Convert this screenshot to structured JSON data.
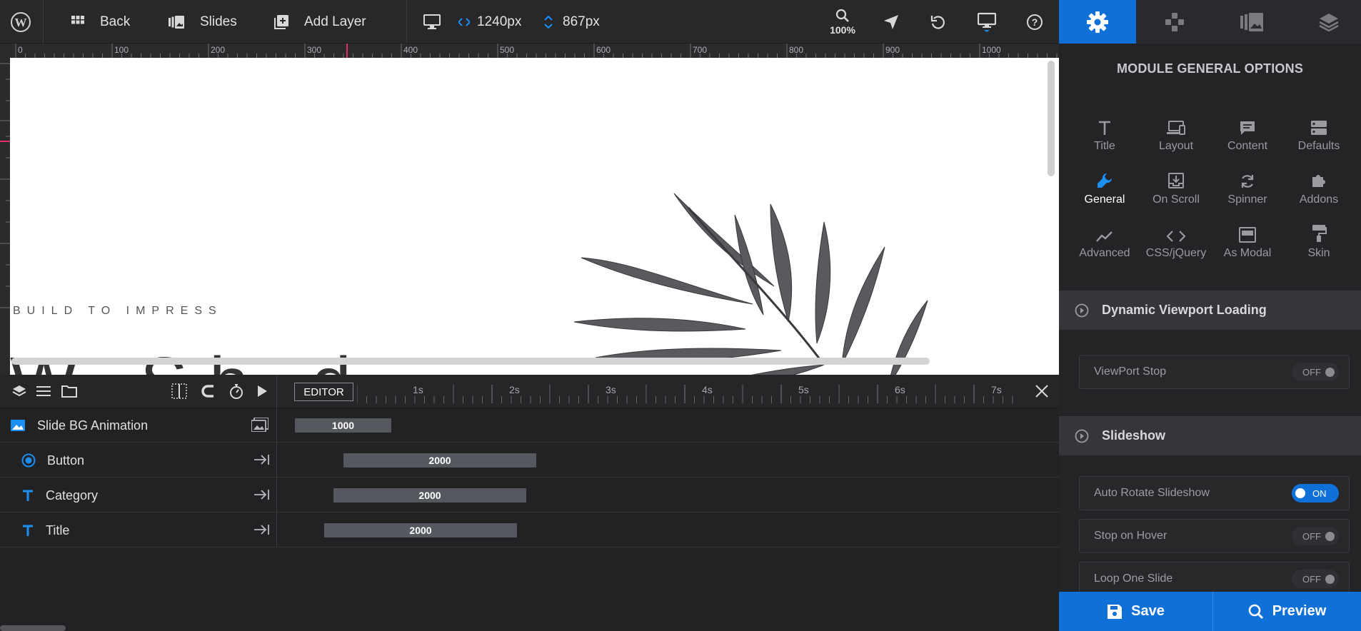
{
  "toolbar": {
    "back_label": "Back",
    "slides_label": "Slides",
    "add_layer_label": "Add Layer",
    "width_value": "1240px",
    "height_value": "867px",
    "zoom_value": "100%"
  },
  "ruler": {
    "labels": [
      "0",
      "100",
      "200",
      "300",
      "400",
      "500",
      "600",
      "700",
      "800",
      "900",
      "1000"
    ]
  },
  "canvas": {
    "tagline": "BUILD TO IMPRESS",
    "big_text": "W    Sh d"
  },
  "timeline": {
    "editor_label": "EDITOR",
    "time_labels": [
      "1s",
      "2s",
      "3s",
      "4s",
      "5s",
      "6s",
      "7s"
    ],
    "rows": [
      {
        "name": "Slide BG Animation",
        "bar_value": "1000"
      },
      {
        "name": "Button",
        "bar_value": "2000"
      },
      {
        "name": "Category",
        "bar_value": "2000"
      },
      {
        "name": "Title",
        "bar_value": "2000"
      }
    ]
  },
  "panel": {
    "title": "MODULE GENERAL OPTIONS",
    "options": [
      "Title",
      "Layout",
      "Content",
      "Defaults",
      "General",
      "On Scroll",
      "Spinner",
      "Addons",
      "Advanced",
      "CSS/jQuery",
      "As Modal",
      "Skin"
    ],
    "active_option": "General",
    "sections": [
      {
        "label": "Dynamic Viewport Loading"
      },
      {
        "label": "Slideshow"
      }
    ],
    "settings": [
      {
        "label": "ViewPort Stop",
        "state": "OFF"
      },
      {
        "label": "Auto Rotate Slideshow",
        "state": "ON"
      },
      {
        "label": "Stop on Hover",
        "state": "OFF"
      },
      {
        "label": "Loop One Slide",
        "state": "OFF"
      }
    ],
    "save_label": "Save",
    "preview_label": "Preview"
  },
  "colors": {
    "accent": "#0f70d8",
    "toolbar_bg": "#28282b",
    "panel_bg": "#242427"
  }
}
